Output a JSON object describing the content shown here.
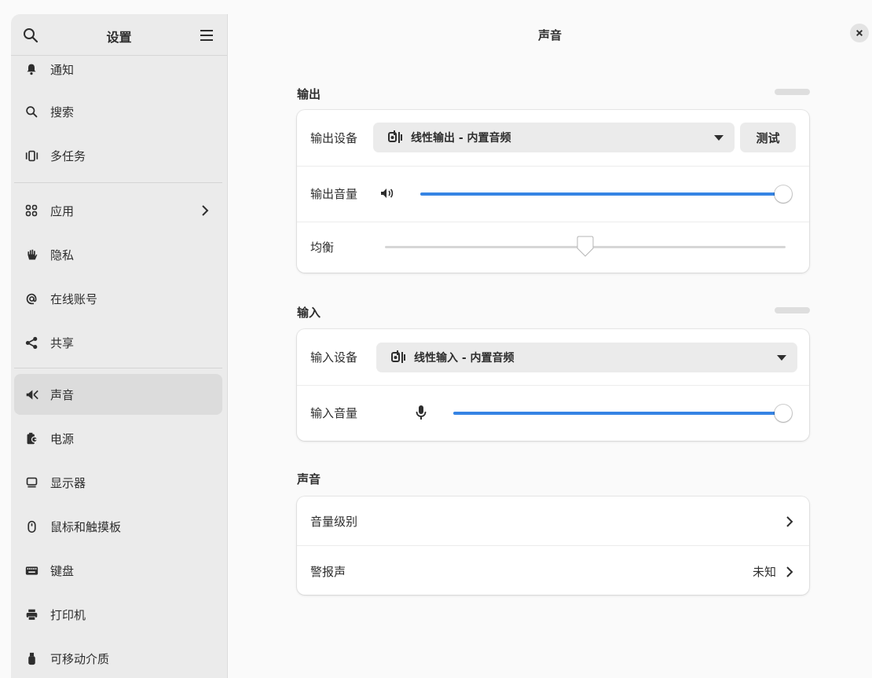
{
  "sidebar": {
    "title": "设置",
    "items": [
      {
        "label": "通知",
        "icon": "bell-icon"
      },
      {
        "label": "搜索",
        "icon": "search-icon"
      },
      {
        "label": "多任务",
        "icon": "multitasking-icon"
      },
      {
        "label": "应用",
        "icon": "apps-grid-icon"
      },
      {
        "label": "隐私",
        "icon": "hand-icon"
      },
      {
        "label": "在线账号",
        "icon": "at-sign-icon"
      },
      {
        "label": "共享",
        "icon": "share-icon"
      },
      {
        "label": "声音",
        "icon": "speaker-icon"
      },
      {
        "label": "电源",
        "icon": "battery-power-icon"
      },
      {
        "label": "显示器",
        "icon": "monitor-icon"
      },
      {
        "label": "鼠标和触摸板",
        "icon": "mouse-icon"
      },
      {
        "label": "键盘",
        "icon": "keyboard-icon"
      },
      {
        "label": "打印机",
        "icon": "printer-icon"
      },
      {
        "label": "可移动介质",
        "icon": "usb-drive-icon"
      }
    ],
    "active_item": "声音"
  },
  "main": {
    "title": "声音",
    "output": {
      "section_title": "输出",
      "device_label": "输出设备",
      "device_value": "线性输出 - 内置音频",
      "test_label": "测试",
      "volume_label": "输出音量",
      "volume_level": 1.0,
      "balance_label": "均衡",
      "balance_level": 0.5
    },
    "input": {
      "section_title": "输入",
      "device_label": "输入设备",
      "device_value": "线性输入 - 内置音频",
      "volume_label": "输入音量",
      "volume_level": 1.0
    },
    "sounds": {
      "section_title": "声音",
      "volume_levels_label": "音量级别",
      "alert_label": "警报声",
      "alert_value": "未知"
    }
  },
  "colors": {
    "accent": "#3584e4",
    "sidebar_bg": "#ebebeb",
    "active_item_bg": "#dcdcdc"
  }
}
